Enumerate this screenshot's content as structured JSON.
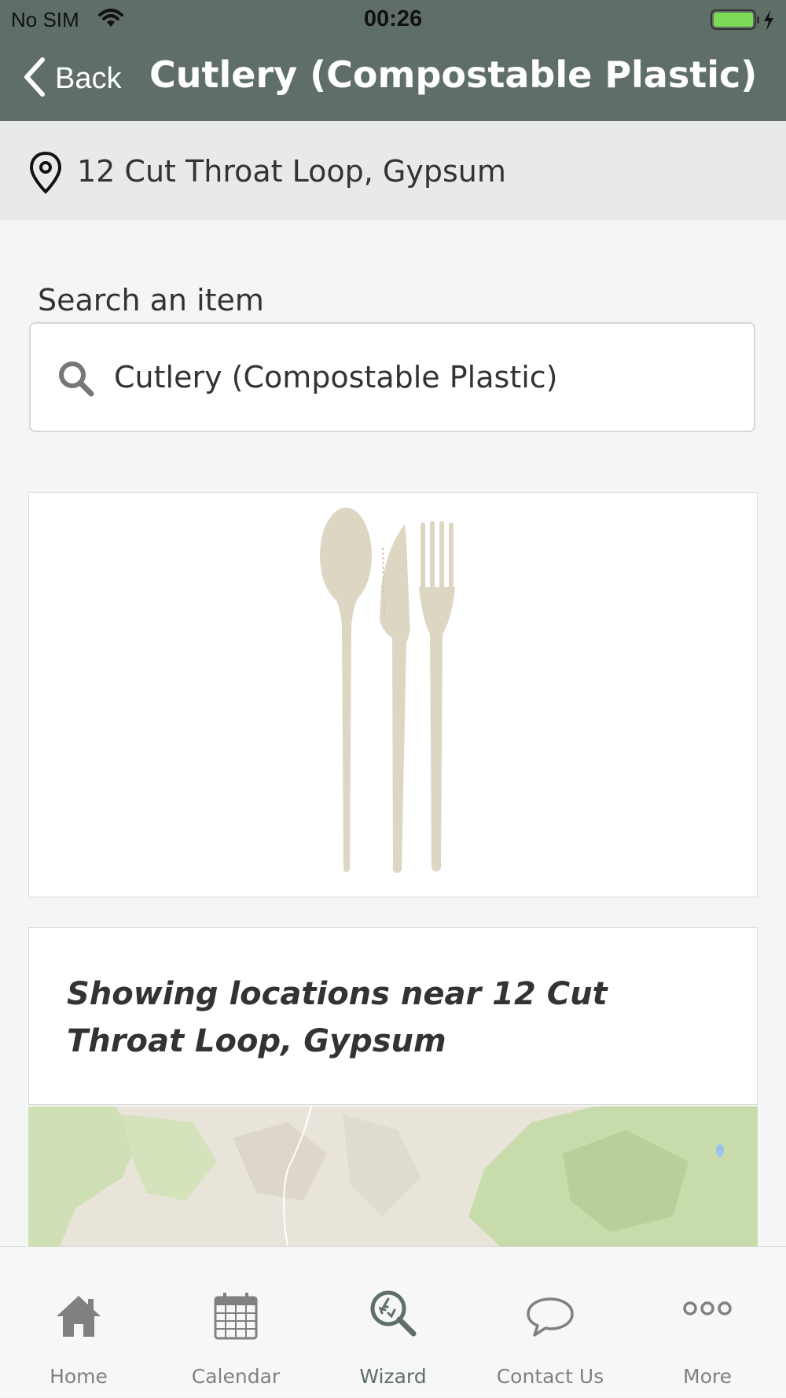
{
  "status_bar": {
    "carrier": "No SIM",
    "time": "00:26"
  },
  "nav": {
    "back_label": "Back",
    "title": "Cutlery (Compostable Plastic)"
  },
  "address": {
    "text": "12 Cut Throat Loop, Gypsum"
  },
  "search": {
    "label": "Search an item",
    "value": "Cutlery (Compostable Plastic)"
  },
  "locations": {
    "heading": "Showing locations near 12 Cut Throat Loop, Gypsum"
  },
  "tabs": [
    {
      "label": "Home",
      "icon": "home-icon"
    },
    {
      "label": "Calendar",
      "icon": "calendar-icon"
    },
    {
      "label": "Wizard",
      "icon": "wizard-icon",
      "active": true
    },
    {
      "label": "Contact Us",
      "icon": "chat-bubble-icon"
    },
    {
      "label": "More",
      "icon": "more-icon"
    }
  ],
  "colors": {
    "header": "#5f6f67",
    "active_tab": "#5f6f67",
    "inactive_tab": "#808080",
    "battery": "#7ed957"
  }
}
